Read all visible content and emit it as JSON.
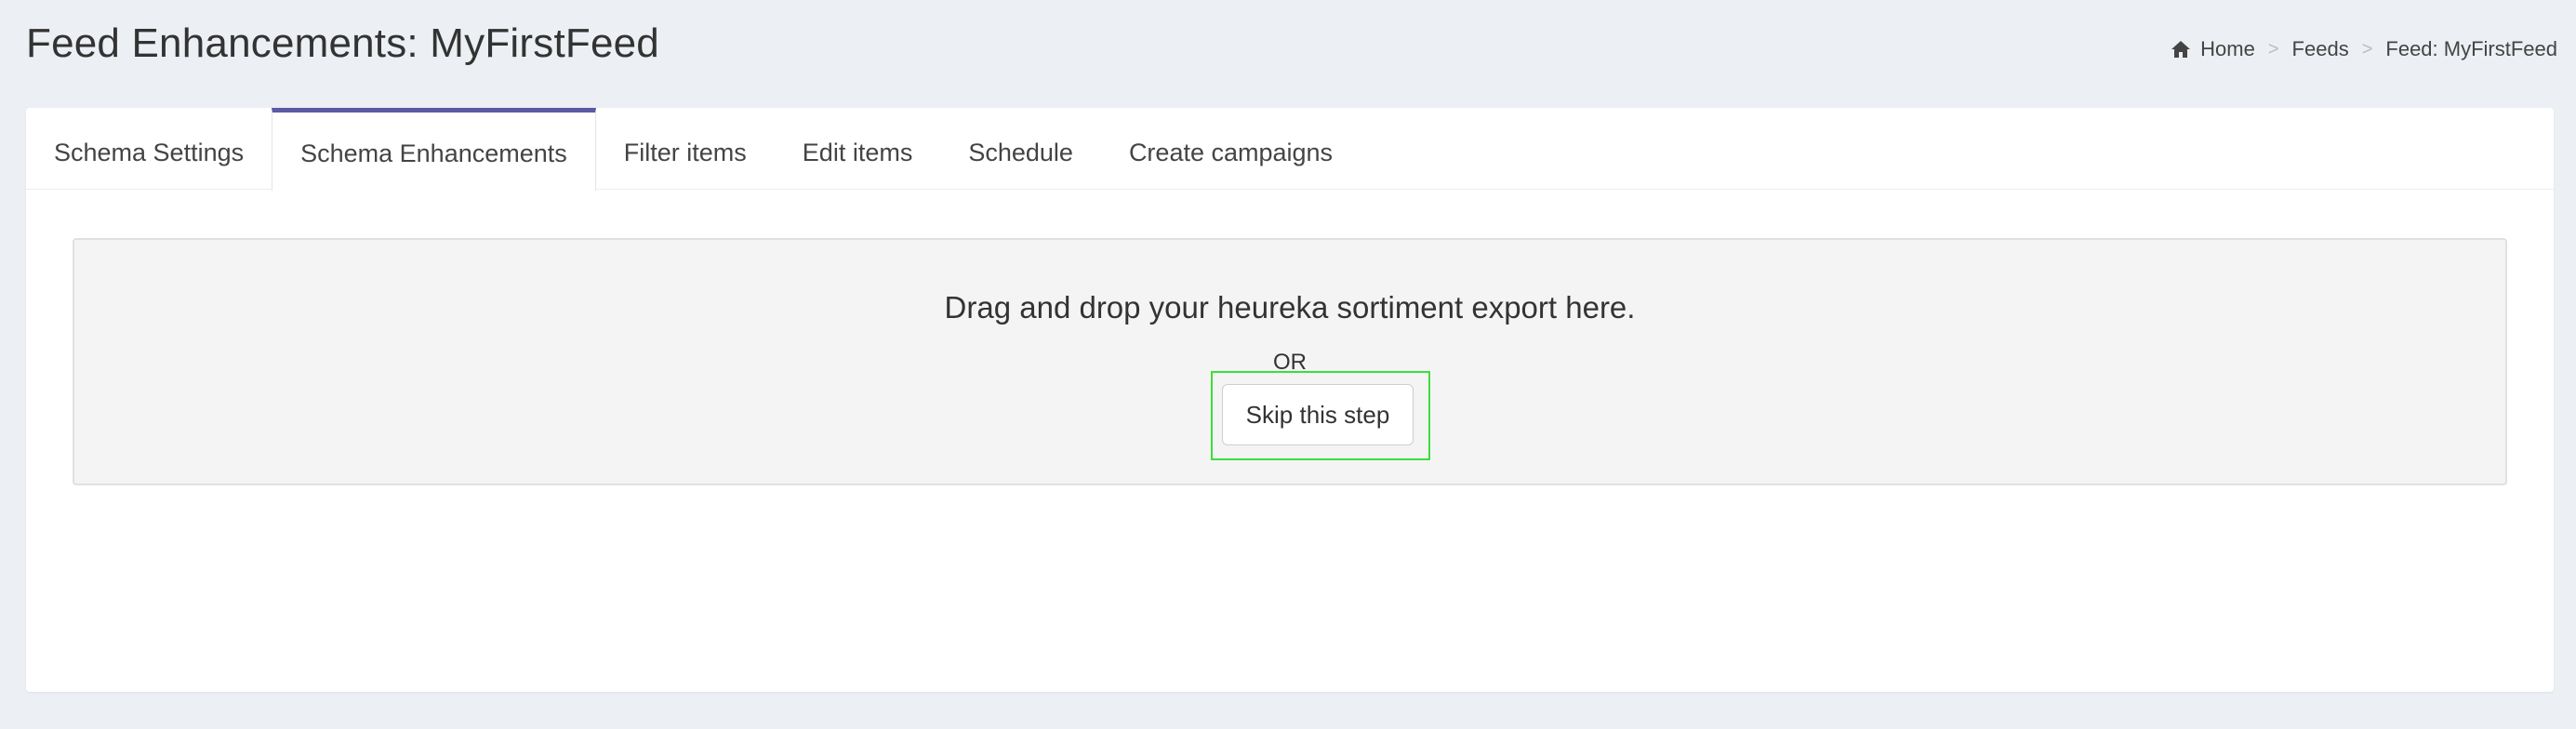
{
  "header": {
    "title": "Feed Enhancements: MyFirstFeed",
    "breadcrumb": [
      {
        "label": "Home",
        "icon": "home-icon"
      },
      {
        "label": "Feeds"
      },
      {
        "label": "Feed: MyFirstFeed"
      }
    ],
    "separator": ">"
  },
  "tabs": [
    {
      "label": "Schema Settings",
      "active": false
    },
    {
      "label": "Schema Enhancements",
      "active": true
    },
    {
      "label": "Filter items",
      "active": false
    },
    {
      "label": "Edit items",
      "active": false
    },
    {
      "label": "Schedule",
      "active": false
    },
    {
      "label": "Create campaigns",
      "active": false
    }
  ],
  "dropzone": {
    "message": "Drag and drop your heureka sortiment export here.",
    "or_text": "OR",
    "skip_label": "Skip this step"
  },
  "colors": {
    "background": "#eceff3",
    "active_tab_accent": "#5b5aa3",
    "highlight": "#3adf3a"
  }
}
